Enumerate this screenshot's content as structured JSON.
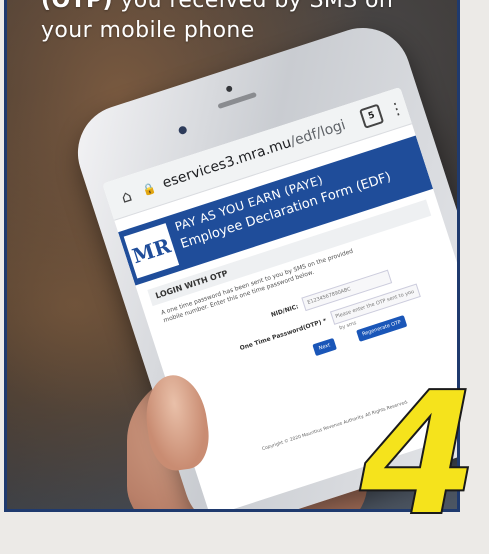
{
  "caption": {
    "line1_bold": "(OTP)",
    "line1_rest": " you received by SMS on",
    "line2": "your mobile phone"
  },
  "browser": {
    "url_host": "eservices3.mra.mu",
    "url_path": "/edf/logi",
    "tab_count": "5"
  },
  "site": {
    "logo": "MR",
    "title": "PAY AS YOU EARN (PAYE)",
    "subtitle": "Employee Declaration Form (EDF)"
  },
  "login": {
    "heading": "LOGIN WITH OTP",
    "note": "A one time password has been sent to you by SMS on the provided mobile number. Enter this one time password below.",
    "nid_label": "NID/NIC:",
    "nid_value": "E1234567890ABC",
    "otp_label": "One Time Password(OTP) *",
    "otp_placeholder": "Please enter the OTP sent to you by sms",
    "next_label": "Next",
    "regenerate_label": "Regenerate OTP",
    "copyright": "Copyright © 2020 Mauritius Revenue Authority. All Rights Reserved."
  },
  "step": {
    "number": "4"
  },
  "colors": {
    "border": "#1f3a6e",
    "banner": "#1f4d9a",
    "step_number": "#f5e31c",
    "button": "#1a56b8"
  }
}
